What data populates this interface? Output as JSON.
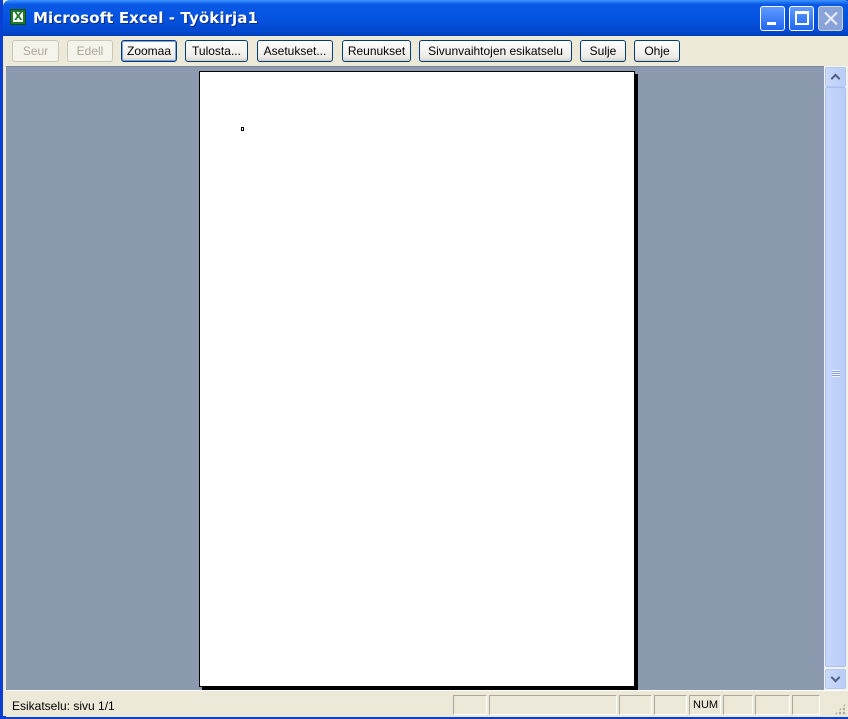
{
  "window": {
    "title": "Microsoft Excel - Työkirja1",
    "icon": "excel-icon"
  },
  "toolbar": {
    "buttons": [
      {
        "label": "Seur",
        "enabled": false
      },
      {
        "label": "Edell",
        "enabled": false
      },
      {
        "label": "Zoomaa",
        "enabled": true
      },
      {
        "label": "Tulosta...",
        "enabled": true
      },
      {
        "label": "Asetukset...",
        "enabled": true
      },
      {
        "label": "Reunukset",
        "enabled": true
      },
      {
        "label": "Sivunvaihtojen esikatselu",
        "enabled": true
      },
      {
        "label": "Sulje",
        "enabled": true
      },
      {
        "label": "Ohje",
        "enabled": true
      }
    ]
  },
  "statusbar": {
    "text": "Esikatselu: sivu 1/1",
    "num_indicator": "NUM"
  },
  "colors": {
    "titlebar": "#0453e0",
    "preview_background": "#8c9ab0",
    "page": "#ffffff"
  }
}
